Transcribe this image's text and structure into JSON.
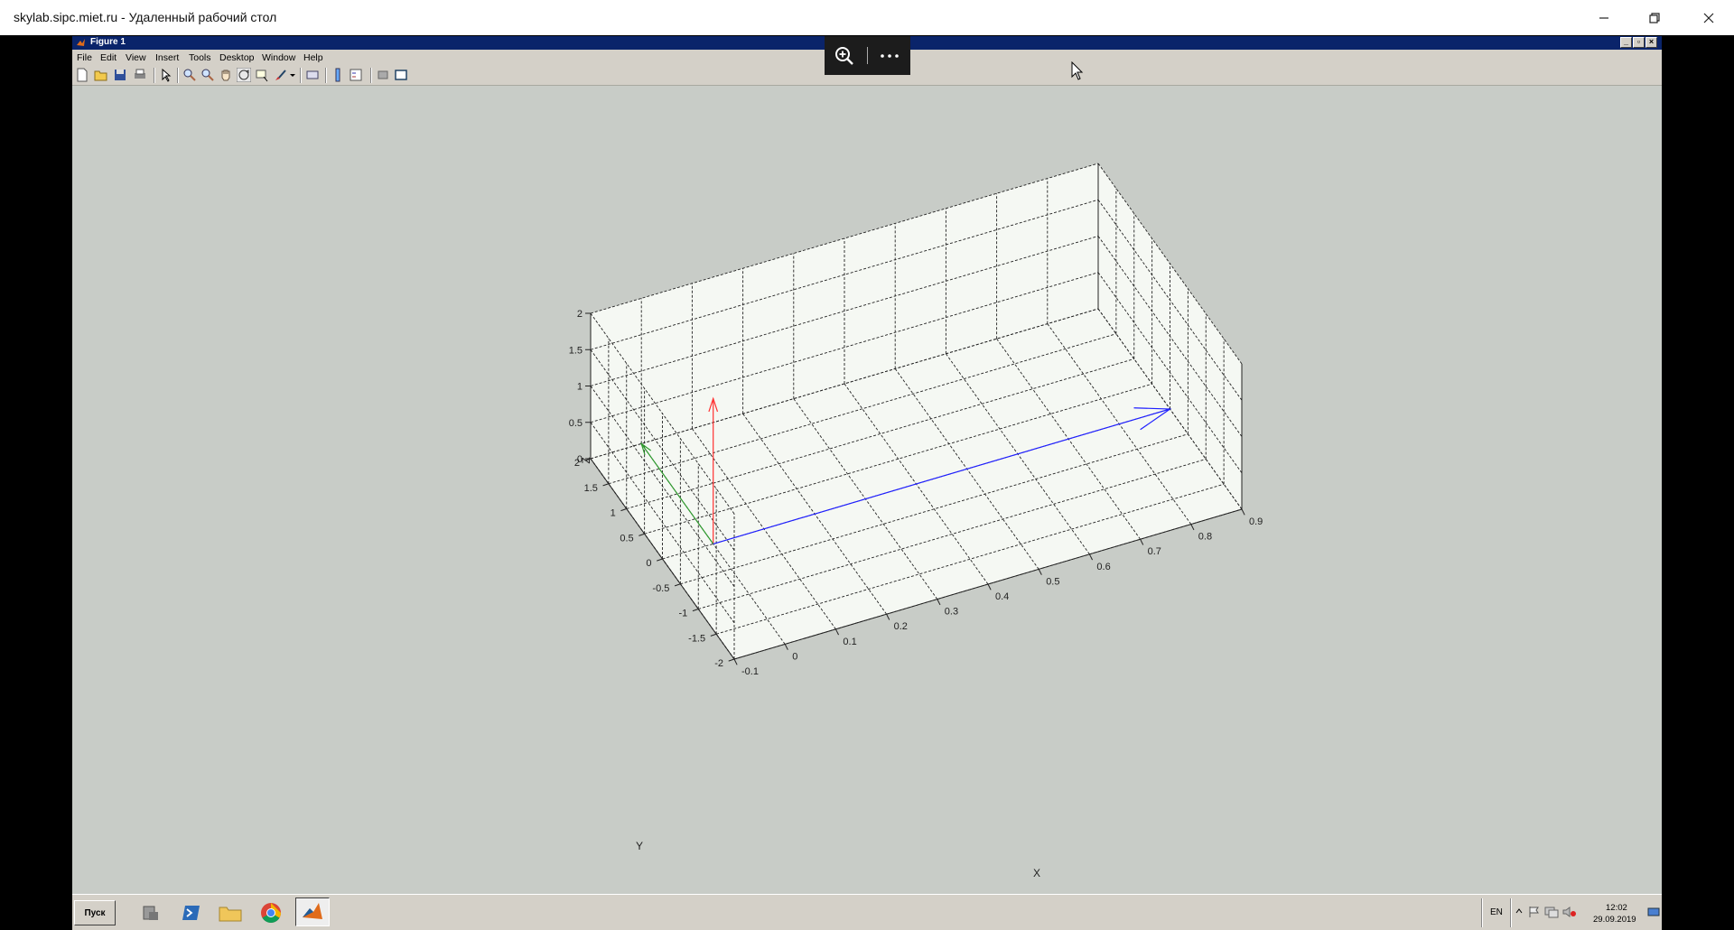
{
  "rdp_window": {
    "title": "skylab.sipc.miet.ru - Удаленный рабочий стол",
    "controls": [
      "minimize-icon",
      "restore-icon",
      "close-icon"
    ]
  },
  "figure_window": {
    "title": "Figure 1",
    "menu": [
      "File",
      "Edit",
      "View",
      "Insert",
      "Tools",
      "Desktop",
      "Window",
      "Help"
    ],
    "toolbar_icons": [
      "new-file-icon",
      "open-folder-icon",
      "save-icon",
      "print-icon",
      "pointer-icon",
      "zoom-in-icon",
      "zoom-out-icon",
      "pan-hand-icon",
      "rotate-3d-icon",
      "data-cursor-icon",
      "brush-icon",
      "link-icon",
      "colorbar-icon",
      "legend-icon",
      "hide-plot-tools-icon",
      "show-plot-tools-icon"
    ]
  },
  "rdp_overlay": {
    "icons": [
      "zoom-icon",
      "more-icon"
    ]
  },
  "chart_data": {
    "type": "3d-quiver",
    "xlabel": "X",
    "ylabel": "Y",
    "zlabel": "Z",
    "x_ticks": [
      "-0.1",
      "0",
      "0.1",
      "0.2",
      "0.3",
      "0.4",
      "0.5",
      "0.6",
      "0.7",
      "0.8",
      "0.9"
    ],
    "y_ticks": [
      "-2",
      "-1.5",
      "-1",
      "-0.5",
      "0",
      "0.5",
      "1",
      "1.5",
      "2"
    ],
    "z_ticks": [
      "0",
      "0.5",
      "1",
      "1.5",
      "2"
    ],
    "xlim": [
      -0.1,
      0.9
    ],
    "ylim": [
      -2,
      2
    ],
    "zlim": [
      0,
      2
    ],
    "grid": true,
    "series": [
      {
        "color": "#ff3030",
        "start": [
          0,
          0,
          0
        ],
        "end": [
          0,
          0,
          2
        ]
      },
      {
        "color": "#2e9a2e",
        "start": [
          0,
          0,
          0
        ],
        "end": [
          0,
          2,
          0
        ]
      },
      {
        "color": "#2020ff",
        "start": [
          0,
          0,
          0
        ],
        "end": [
          0.9,
          0,
          0
        ]
      }
    ]
  },
  "taskbar": {
    "start_label": "Пуск",
    "apps": [
      "server-manager-icon",
      "powershell-icon",
      "explorer-icon",
      "chrome-icon",
      "matlab-icon"
    ],
    "language": "EN",
    "time": "12:02",
    "date": "29.09.2019"
  }
}
